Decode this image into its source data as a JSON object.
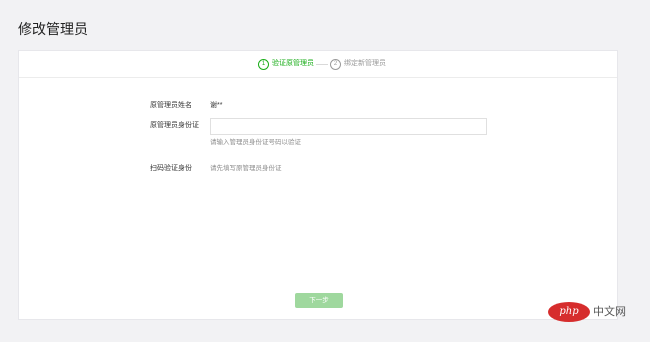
{
  "page": {
    "title": "修改管理员"
  },
  "steps": [
    {
      "number": "1",
      "label": "验证原管理员",
      "state": "active"
    },
    {
      "number": "2",
      "label": "绑定新管理员",
      "state": "inactive"
    }
  ],
  "form": {
    "name_label": "原管理员姓名",
    "name_value": "谢**",
    "id_label": "原管理员身份证",
    "id_value": "",
    "id_hint": "请输入管理员身份证号码以验证",
    "scan_label": "扫码验证身份",
    "scan_hint": "请先填写原管理员身份证"
  },
  "actions": {
    "next_label": "下一步"
  },
  "watermark": {
    "logo": "php",
    "text": "中文网"
  },
  "colors": {
    "accent": "#1aad19",
    "button_disabled": "#9fd89e",
    "background": "#f2f2f4",
    "panel": "#ffffff"
  },
  "icons": [
    "step-number-icon"
  ]
}
